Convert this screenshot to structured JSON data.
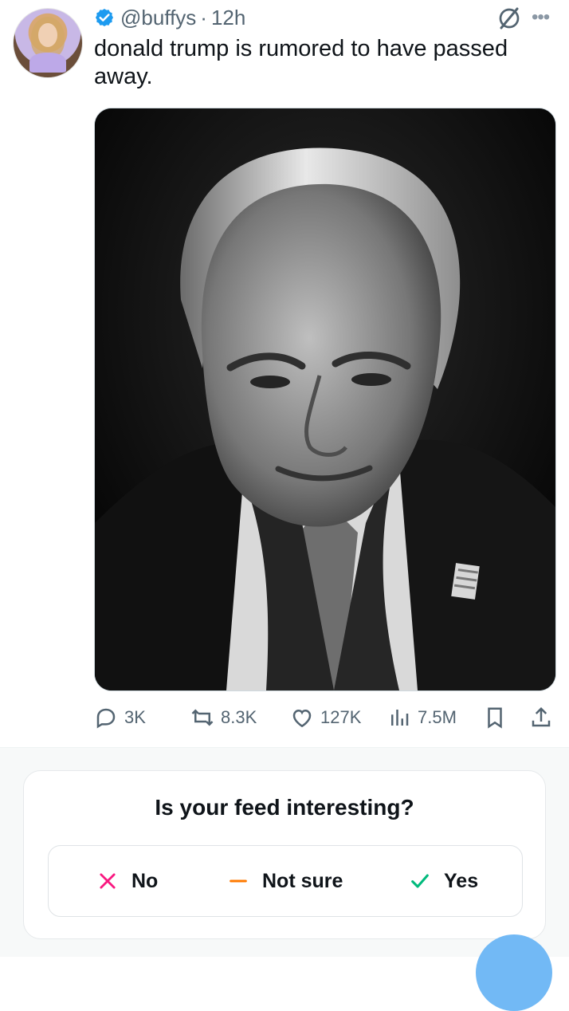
{
  "tweet": {
    "handle": "@buffys",
    "separator": "·",
    "time": "12h",
    "text": "donald trump is rumored to have passed away.",
    "icons": {
      "verified": "verified-badge-icon",
      "grok": "grok-icon",
      "more": "more-icon"
    }
  },
  "actions": {
    "reply": "3K",
    "retweet": "8.3K",
    "like": "127K",
    "views": "7.5M"
  },
  "survey": {
    "title": "Is your feed interesting?",
    "options": [
      {
        "label": "No",
        "icon": "x-icon",
        "color": "#f91880"
      },
      {
        "label": "Not sure",
        "icon": "minus-icon",
        "color": "#ff7a00"
      },
      {
        "label": "Yes",
        "icon": "check-icon",
        "color": "#00ba7c"
      }
    ]
  },
  "colors": {
    "accent": "#1d9bf0",
    "muted": "#536471"
  }
}
